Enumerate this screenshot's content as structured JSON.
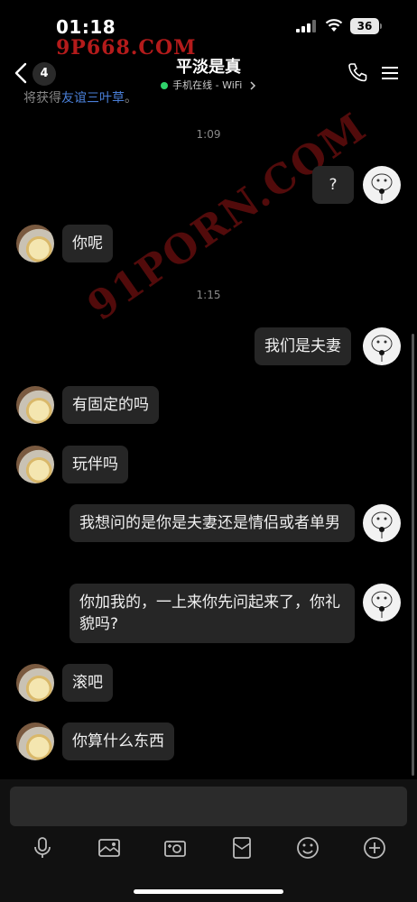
{
  "status_bar": {
    "time": "01:18",
    "battery": "36"
  },
  "watermarks": {
    "top": "9P668.COM",
    "diagonal": "91PORN.COM"
  },
  "header": {
    "unread_count": "4",
    "title": "平淡是真",
    "status": "手机在线 - WiFi"
  },
  "partial_text": {
    "prefix": "将获得",
    "link": "友谊三叶草",
    "suffix": "。"
  },
  "messages": [
    {
      "type": "time",
      "text": "1:09"
    },
    {
      "type": "out",
      "text": "?"
    },
    {
      "type": "in",
      "text": "你呢"
    },
    {
      "type": "time",
      "text": "1:15"
    },
    {
      "type": "out",
      "text": "我们是夫妻"
    },
    {
      "type": "in",
      "text": "有固定的吗"
    },
    {
      "type": "in",
      "text": "玩伴吗"
    },
    {
      "type": "out",
      "text": "我想问的是你是夫妻还是情侣或者单男"
    },
    {
      "type": "out",
      "text": "你加我的，一上来你先问起来了，你礼貌吗?"
    },
    {
      "type": "in",
      "text": "滚吧"
    },
    {
      "type": "in",
      "text": "你算什么东西"
    }
  ],
  "toolbar": [
    "microphone-icon",
    "image-icon",
    "camera-icon",
    "red-packet-icon",
    "emoji-icon",
    "plus-icon"
  ],
  "colors": {
    "background": "#000000",
    "bubble": "#262626",
    "online": "#2fd36b",
    "link": "#4a7fd8",
    "watermark": "#c81e1e"
  }
}
